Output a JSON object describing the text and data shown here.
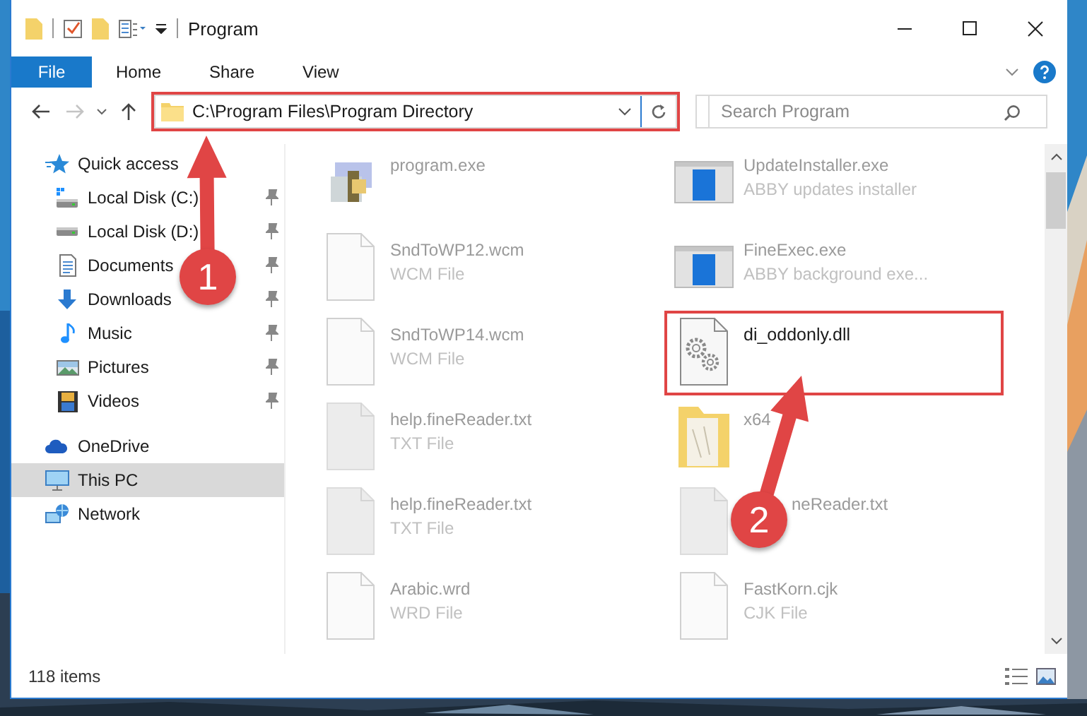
{
  "window": {
    "title": "Program"
  },
  "ribbon_tabs": [
    {
      "label": "File",
      "selected": true
    },
    {
      "label": "Home",
      "selected": false
    },
    {
      "label": "Share",
      "selected": false
    },
    {
      "label": "View",
      "selected": false
    }
  ],
  "address_bar": {
    "path": "C:\\Program Files\\Program Directory",
    "highlighted": true
  },
  "search": {
    "placeholder": "Search Program"
  },
  "navigation": [
    {
      "label": "Quick access",
      "kind": "star",
      "selected": false,
      "children": [
        {
          "label": "Local Disk (C:)",
          "kind": "system-drive",
          "pinned": true,
          "selected": false
        },
        {
          "label": "Local Disk (D:)",
          "kind": "drive",
          "pinned": true,
          "selected": false
        },
        {
          "label": "Documents",
          "kind": "documents",
          "pinned": true,
          "selected": false
        },
        {
          "label": "Downloads",
          "kind": "downloads",
          "pinned": true,
          "selected": false
        },
        {
          "label": "Music",
          "kind": "music",
          "pinned": true,
          "selected": false
        },
        {
          "label": "Pictures",
          "kind": "pictures",
          "pinned": true,
          "selected": false
        },
        {
          "label": "Videos",
          "kind": "videos",
          "pinned": true,
          "selected": false
        }
      ]
    },
    {
      "label": "OneDrive",
      "kind": "cloud",
      "selected": false
    },
    {
      "label": "This PC",
      "kind": "computer",
      "selected": true
    },
    {
      "label": "Network",
      "kind": "network",
      "selected": false
    }
  ],
  "files": [
    {
      "name": "program.exe",
      "kind": "installer",
      "highlighted": false
    },
    {
      "name": "UpdateInstaller.exe",
      "type": "ABBY updates installer",
      "kind": "app",
      "highlighted": false
    },
    {
      "name": "SndToWP12.wcm",
      "type": "WCM File",
      "kind": "document",
      "highlighted": false
    },
    {
      "name": "FineExec.exe",
      "type": "ABBY background exe...",
      "kind": "app",
      "highlighted": false
    },
    {
      "name": "SndToWP14.wcm",
      "type": "WCM File",
      "kind": "document",
      "highlighted": false
    },
    {
      "name": "di_oddonly.dll",
      "kind": "dll",
      "highlighted": true
    },
    {
      "name": "help.fineReader.txt",
      "type": "TXT File",
      "kind": "text",
      "highlighted": false
    },
    {
      "name": "x64",
      "kind": "folder",
      "highlighted": false
    },
    {
      "name": "help.fineReader.txt",
      "type": "TXT File",
      "kind": "text",
      "highlighted": false
    },
    {
      "name": "neReader.txt",
      "kind": "text",
      "highlighted": false
    },
    {
      "name": "Arabic.wrd",
      "type": "WRD File",
      "kind": "document",
      "highlighted": false
    },
    {
      "name": "FastKorn.cjk",
      "type": "CJK File",
      "kind": "document",
      "highlighted": false
    }
  ],
  "status_bar": {
    "item_count": "118 items"
  },
  "annotations": [
    {
      "label": "1"
    },
    {
      "label": "2"
    }
  ]
}
